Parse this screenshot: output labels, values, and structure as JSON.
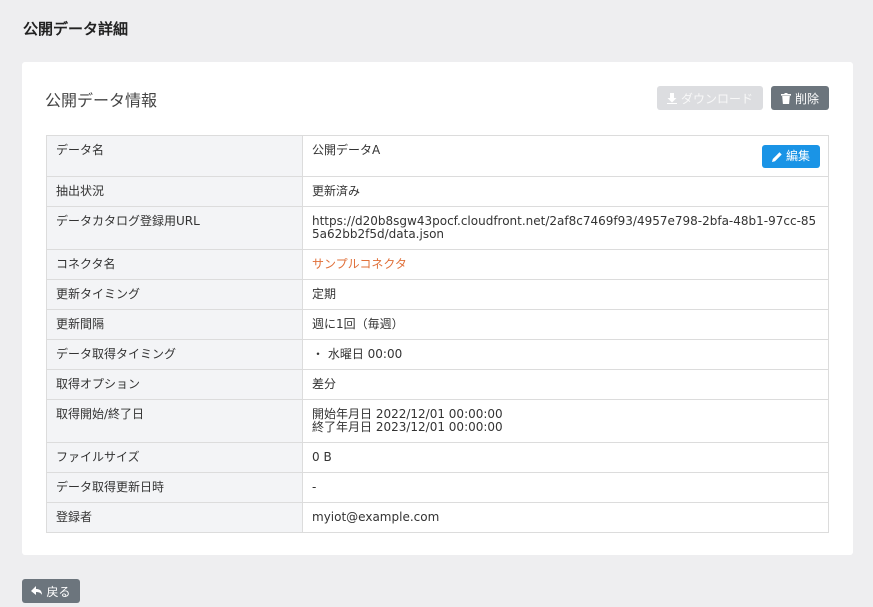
{
  "page": {
    "title": "公開データ詳細"
  },
  "card": {
    "title": "公開データ情報"
  },
  "toolbar": {
    "download_label": "ダウンロード",
    "delete_label": "削除",
    "edit_label": "編集"
  },
  "footer": {
    "back_label": "戻る"
  },
  "rows": [
    {
      "label": "データ名",
      "value": "公開データA"
    },
    {
      "label": "抽出状況",
      "value": "更新済み"
    },
    {
      "label": "データカタログ登録用URL",
      "value": "https://d20b8sgw43pocf.cloudfront.net/2af8c7469f93/4957e798-2bfa-48b1-97cc-855a62bb2f5d/data.json"
    },
    {
      "label": "コネクタ名",
      "value": "サンプルコネクタ"
    },
    {
      "label": "更新タイミング",
      "value": "定期"
    },
    {
      "label": "更新間隔",
      "value": "週に1回（毎週）"
    },
    {
      "label": "データ取得タイミング",
      "value": "・ 水曜日  00:00"
    },
    {
      "label": "取得オプション",
      "value": "差分"
    },
    {
      "label": "取得開始/終了日",
      "value": "開始年月日 2022/12/01 00:00:00",
      "value2": "終了年月日 2023/12/01 00:00:00"
    },
    {
      "label": "ファイルサイズ",
      "value": "0 B"
    },
    {
      "label": "データ取得更新日時",
      "value": "-"
    },
    {
      "label": "登録者",
      "value": "myiot@example.com"
    }
  ],
  "colors": {
    "accent": "#1a94e6",
    "link": "#e0703a",
    "secondary": "#6c757d"
  },
  "icons": [
    "download-icon",
    "trash-icon",
    "pencil-icon",
    "back-arrow-icon"
  ]
}
